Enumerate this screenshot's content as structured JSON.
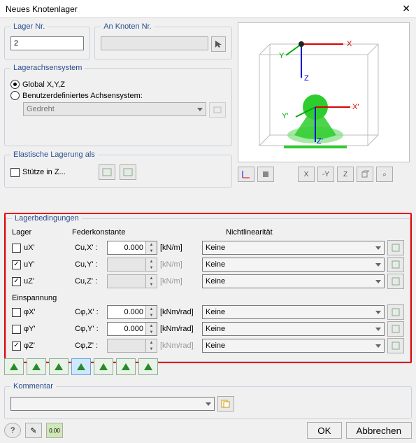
{
  "window": {
    "title": "Neues Knotenlager"
  },
  "lager_nr": {
    "legend": "Lager Nr.",
    "value": "2"
  },
  "an_knoten": {
    "legend": "An Knoten Nr.",
    "value": ""
  },
  "achs": {
    "legend": "Lagerachsensystem",
    "opt_global": "Global X,Y,Z",
    "opt_user": "Benutzerdefiniertes Achsensystem:",
    "user_select": "Gedreht",
    "selected": "global"
  },
  "elastic": {
    "legend": "Elastische Lagerung als",
    "opt_stutze": "Stütze in Z..."
  },
  "preview_toolbar": {
    "modeA": "axes",
    "modeB": "solid",
    "viewX": "X",
    "viewY": "-Y",
    "viewZ": "Z",
    "iso": "3D",
    "zoom": "⌕"
  },
  "cond": {
    "legend": "Lagerbedingungen",
    "head_lager": "Lager",
    "head_feder": "Federkonstante",
    "head_nl": "Nichtlinearität",
    "sub_einsp": "Einspannung",
    "rows_trans": [
      {
        "key": "uX'",
        "label": "Cu,X' :",
        "val": "0.000",
        "unit": "[kN/m]",
        "enabled_spin": true,
        "checked": false,
        "nl": "Keine"
      },
      {
        "key": "uY'",
        "label": "Cu,Y' :",
        "val": "",
        "unit": "[kN/m]",
        "enabled_spin": false,
        "checked": true,
        "nl": "Keine"
      },
      {
        "key": "uZ'",
        "label": "Cu,Z' :",
        "val": "",
        "unit": "[kN/m]",
        "enabled_spin": false,
        "checked": true,
        "nl": "Keine"
      }
    ],
    "rows_rot": [
      {
        "key": "φX'",
        "label": "Cφ,X' :",
        "val": "0.000",
        "unit": "[kNm/rad]",
        "enabled_spin": true,
        "checked": false,
        "nl": "Keine"
      },
      {
        "key": "φY'",
        "label": "Cφ,Y' :",
        "val": "0.000",
        "unit": "[kNm/rad]",
        "enabled_spin": true,
        "checked": false,
        "nl": "Keine"
      },
      {
        "key": "φZ'",
        "label": "Cφ,Z' :",
        "val": "",
        "unit": "[kNm/rad]",
        "enabled_spin": false,
        "checked": true,
        "nl": "Keine"
      }
    ]
  },
  "iconstrip": [
    "type-a",
    "type-b",
    "type-c",
    "type-d",
    "type-e",
    "type-f",
    "type-g"
  ],
  "kommentar": {
    "legend": "Kommentar",
    "value": ""
  },
  "footer": {
    "help": "?",
    "edit": "✎",
    "calc": "0.00",
    "ok": "OK",
    "cancel": "Abbrechen"
  }
}
